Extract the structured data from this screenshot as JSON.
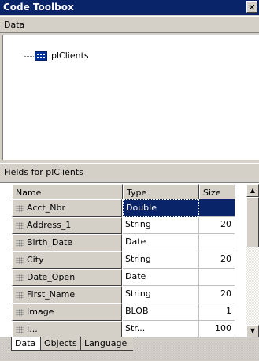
{
  "window": {
    "title": "Code Toolbox",
    "close_label": "✕"
  },
  "data_section": {
    "label": "Data"
  },
  "tree": {
    "items": [
      {
        "label": "plClients",
        "icon": "table-icon"
      }
    ]
  },
  "fields_section": {
    "label": "Fields for plClients"
  },
  "grid": {
    "columns": [
      "Name",
      "Type",
      "Size"
    ],
    "rows": [
      {
        "name": "Acct_Nbr",
        "type": "Double",
        "size": ""
      },
      {
        "name": "Address_1",
        "type": "String",
        "size": "20"
      },
      {
        "name": "Birth_Date",
        "type": "Date",
        "size": ""
      },
      {
        "name": "City",
        "type": "String",
        "size": "20"
      },
      {
        "name": "Date_Open",
        "type": "Date",
        "size": ""
      },
      {
        "name": "First_Name",
        "type": "String",
        "size": "20"
      },
      {
        "name": "Image",
        "type": "BLOB",
        "size": "1"
      },
      {
        "name": "I...",
        "type": "Str...",
        "size": "100"
      }
    ],
    "selected_row": 0
  },
  "tabs": [
    {
      "label": "Data",
      "active": true
    },
    {
      "label": "Objects",
      "active": false
    },
    {
      "label": "Language",
      "active": false
    }
  ]
}
